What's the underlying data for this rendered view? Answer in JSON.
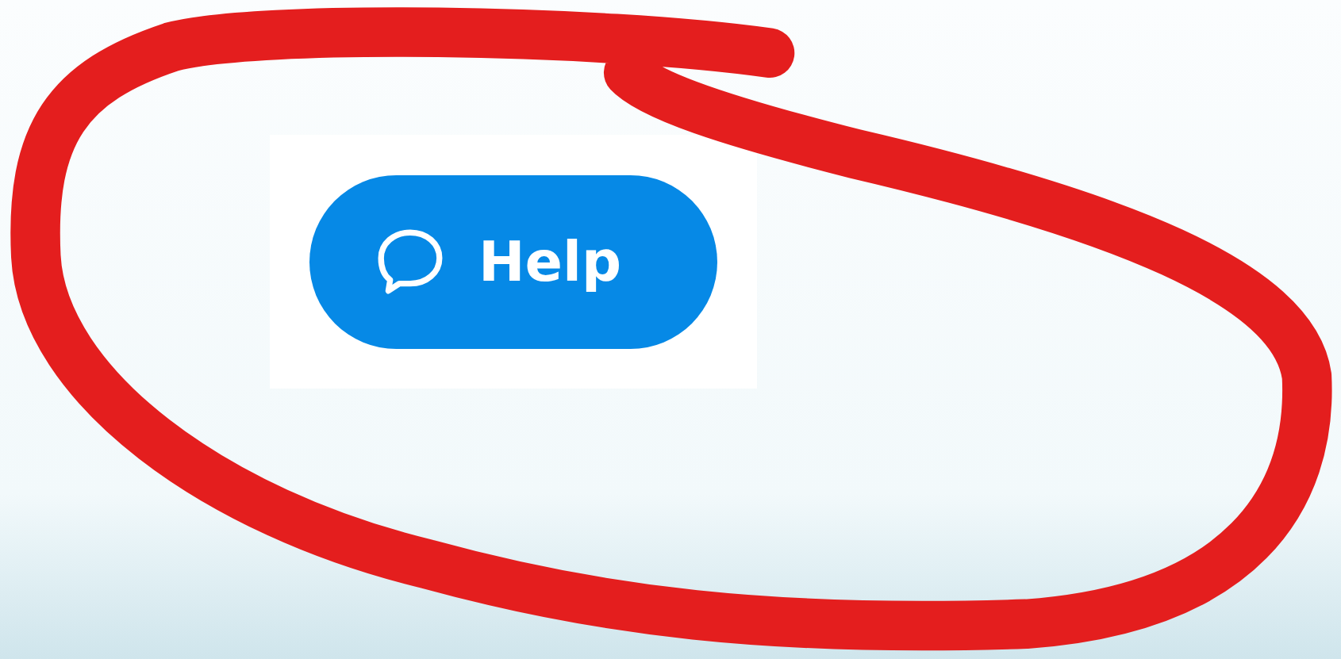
{
  "help_button": {
    "label": "Help"
  }
}
